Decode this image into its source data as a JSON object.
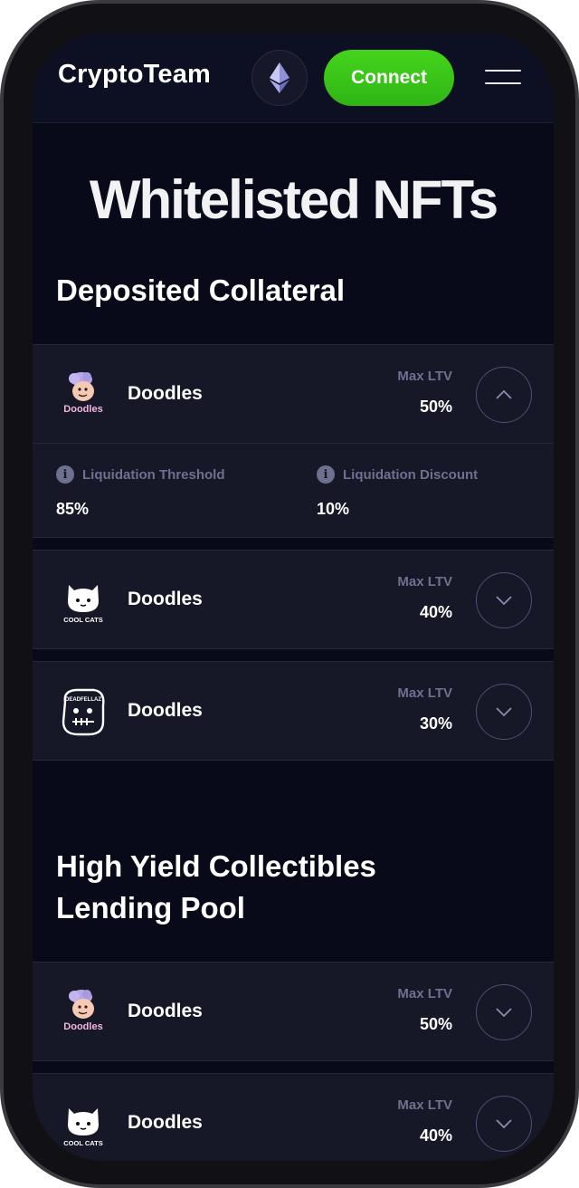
{
  "header": {
    "brand": "CryptoTeam",
    "connect_label": "Connect",
    "eth_icon": "ethereum-icon",
    "menu_icon": "hamburger-menu-icon"
  },
  "page_title": "Whitelisted NFTs",
  "sections": [
    {
      "title": "Deposited Collateral",
      "items": [
        {
          "name": "Doodles",
          "logo": "doodles-logo",
          "logo_text": "Doodles",
          "ltv_label": "Max LTV",
          "ltv_value": "50%",
          "expanded": true,
          "details": [
            {
              "label": "Liquidation Threshold",
              "value": "85%"
            },
            {
              "label": "Liquidation Discount",
              "value": "10%"
            }
          ]
        },
        {
          "name": "Doodles",
          "logo": "cool-cats-logo",
          "logo_text": "COOL CATS",
          "ltv_label": "Max LTV",
          "ltv_value": "40%"
        },
        {
          "name": "Doodles",
          "logo": "deadfellaz-logo",
          "logo_text": "DEADFELLAZ",
          "ltv_label": "Max LTV",
          "ltv_value": "30%"
        }
      ]
    },
    {
      "title_line1": "High Yield Collectibles",
      "title_line2": "Lending Pool",
      "items": [
        {
          "name": "Doodles",
          "logo": "doodles-logo",
          "logo_text": "Doodles",
          "ltv_label": "Max LTV",
          "ltv_value": "50%"
        },
        {
          "name": "Doodles",
          "logo": "cool-cats-logo",
          "logo_text": "COOL CATS",
          "ltv_label": "Max LTV",
          "ltv_value": "40%"
        }
      ]
    }
  ],
  "colors": {
    "background": "#080a1a",
    "card": "#161827",
    "accent_green": "#3cc41a",
    "muted_text": "#6e7090"
  }
}
